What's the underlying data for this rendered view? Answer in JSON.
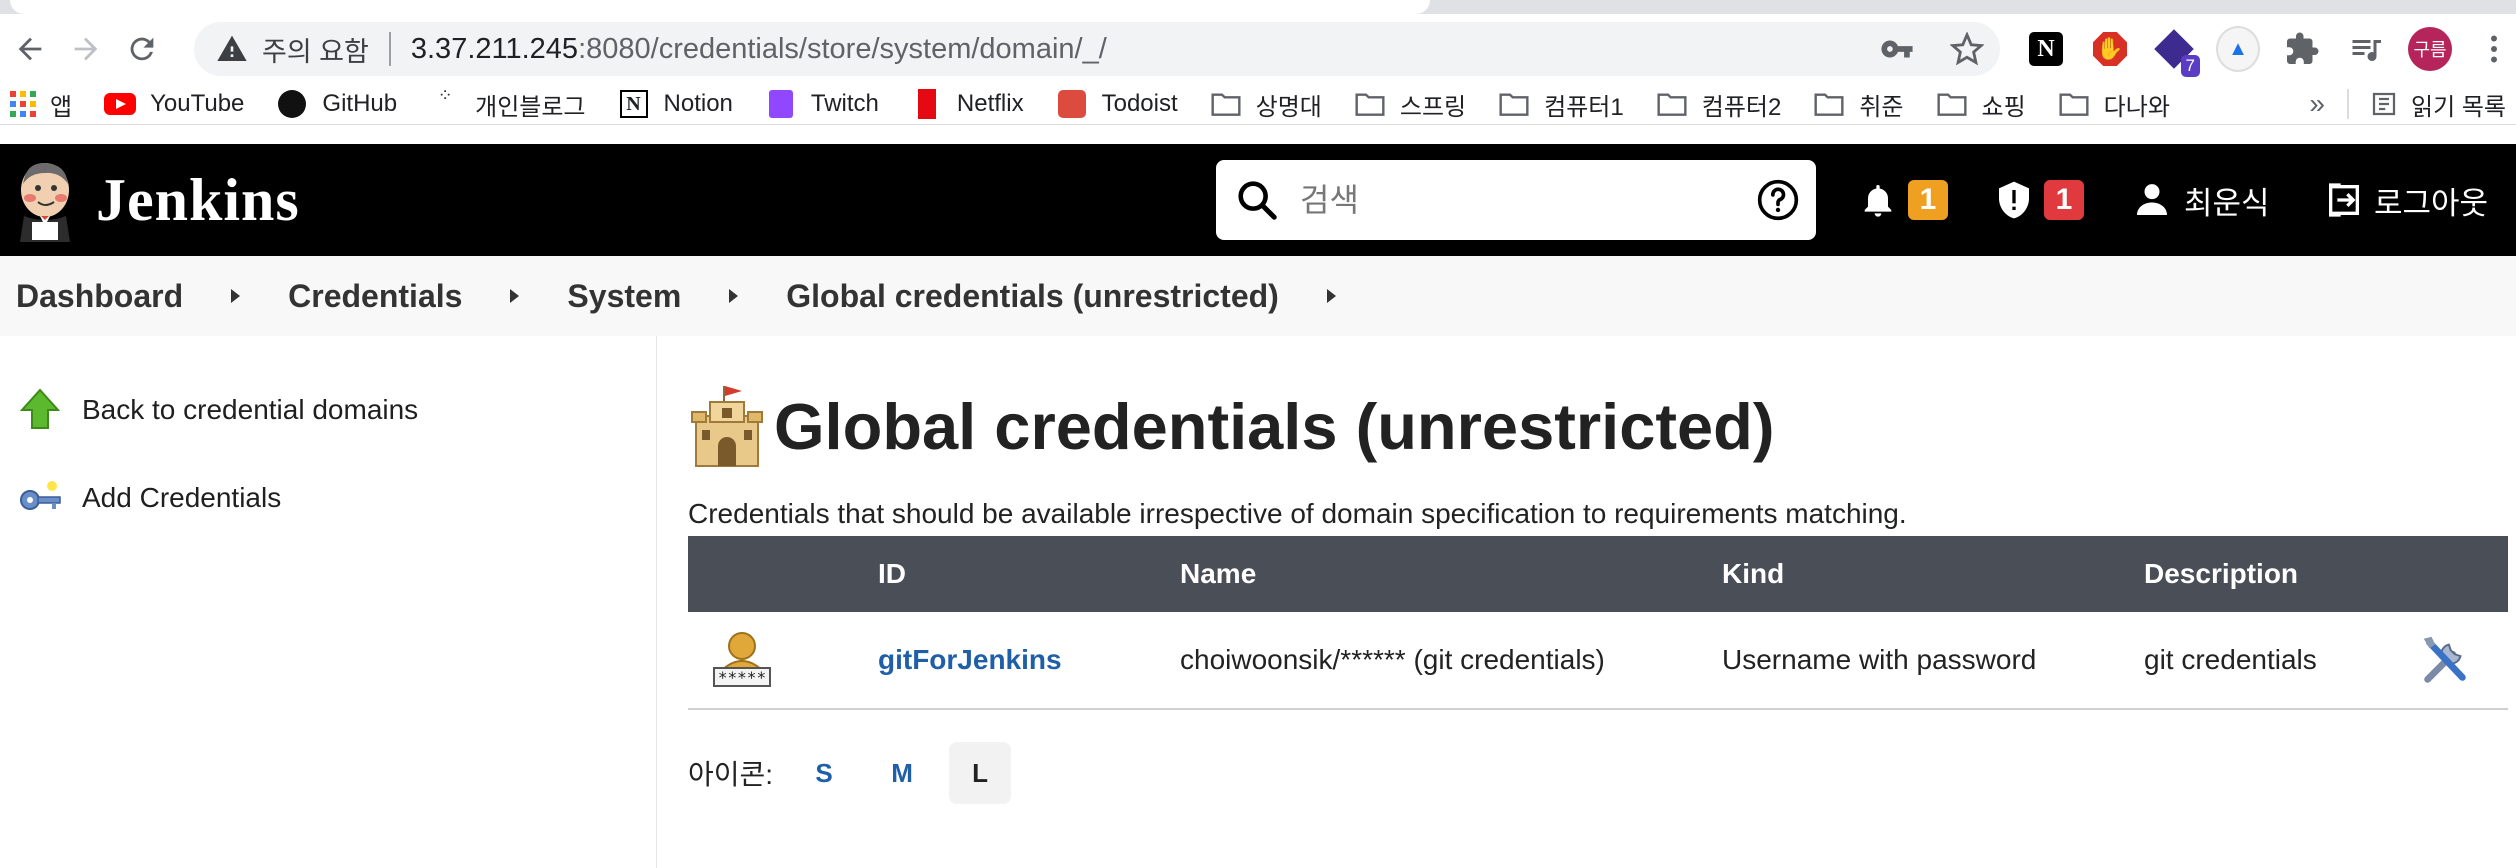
{
  "browser": {
    "security_label": "주의 요함",
    "url_host": "3.37.211.245",
    "url_path": ":8080/credentials/store/system/domain/_/",
    "ext_badge": "7",
    "profile_label": "구름",
    "bookmarks": {
      "apps": "앱",
      "items": [
        "YouTube",
        "GitHub",
        "개인블로그",
        "Notion",
        "Twitch",
        "Netflix",
        "Todoist"
      ],
      "folders": [
        "상명대",
        "스프링",
        "컴퓨터1",
        "컴퓨터2",
        "취준",
        "쇼핑",
        "다나와"
      ],
      "more": "»",
      "reading_list": "읽기 목록"
    }
  },
  "jenkins": {
    "title": "Jenkins",
    "search_placeholder": "검색",
    "notifications_count": "1",
    "security_count": "1",
    "user_name": "최운식",
    "logout_label": "로그아웃",
    "colors": {
      "header_bg": "#000000",
      "notif_badge": "#f0a020",
      "security_badge": "#e0393e",
      "link": "#1f5fa8",
      "table_header": "#4a4e57"
    }
  },
  "breadcrumb": [
    "Dashboard",
    "Credentials",
    "System",
    "Global credentials (unrestricted)"
  ],
  "side_panel": {
    "tasks": [
      {
        "label": "Back to credential domains",
        "icon": "up-arrow-icon"
      },
      {
        "label": "Add Credentials",
        "icon": "key-icon"
      }
    ]
  },
  "main": {
    "title": "Global credentials (unrestricted)",
    "description": "Credentials that should be available irrespective of domain specification to requirements matching.",
    "table": {
      "headers": [
        "ID",
        "Name",
        "Kind",
        "Description"
      ],
      "rows": [
        {
          "id": "gitForJenkins",
          "name": "choiwoonsik/****** (git credentials)",
          "kind": "Username with password",
          "description": "git credentials"
        }
      ]
    },
    "icon_size": {
      "label": "아이콘:",
      "options": [
        "S",
        "M",
        "L"
      ],
      "selected": "L"
    }
  }
}
